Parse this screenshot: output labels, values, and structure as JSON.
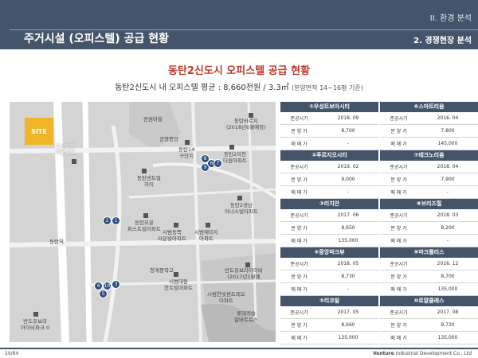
{
  "header": {
    "section": "II. 환경 분석",
    "title": "주거시설 (오피스텔) 공급 현황",
    "subsection": "2. 경쟁현장 분석"
  },
  "main_title": "동탄2신도시 오피스텔 공급 현황",
  "sub_title": "동탄2신도시 내 오피스텔 평균 : 8,660천원 / 3.3㎡",
  "sub_note": "(분양면적 14~16평 기준)",
  "map": {
    "site_label": "SITE",
    "labels": {
      "jeonwon": "전원마을",
      "hanshin": "한신더휴\n어반파크",
      "gongyeong": "공영중앙",
      "dongtan14": "동탄14\n구단지",
      "dongtan_sentral": "동탄센트럴\n자이",
      "dongtan_baruji": "동탄바르지\n(2018년6월예정)",
      "dongtan_ichen": "동탄2이천\n더원아파트",
      "dongtan2_neul": "동탄2경남\n아너스빌아파트",
      "dongtan_ogol": "동탄모골\n퍼스트빌아파트",
      "sibeom_buyeong": "시범동쪽\n라온빌아파트",
      "sibeom_eden": "시범예미지\n아파트",
      "dongtan_station": "동탄역",
      "cheonggye": "청계중학교",
      "sibeom_daewoo": "시범대림\n칸트빌아파트",
      "bandoyu": "반도유보라아이비\n(2017년1월예",
      "sibeom_hanbit": "시범한빛센트레오\n아파트",
      "lotte": "롯데캐슬\n알바트로스",
      "bando_ivy": "반도유보라\n아이비파크 0"
    },
    "pins": [
      "1",
      "2",
      "3",
      "4",
      "5",
      "6",
      "7",
      "8",
      "9",
      "10"
    ]
  },
  "table_labels": {
    "date": "준공시기",
    "price": "분 양 가",
    "sale": "매 매 가"
  },
  "properties": [
    {
      "name": "①우성트보아시티",
      "date": "2018. 09",
      "price": "8,700",
      "sale": "-"
    },
    {
      "name": "⑥스마트리움",
      "date": "2016. 04",
      "price": "7,800",
      "sale": "145,000"
    },
    {
      "name": "②푸르지오시티",
      "date": "2019. 02",
      "price": "9,000",
      "sale": "-"
    },
    {
      "name": "⑦테크노리움",
      "date": "2018. 04",
      "price": "7,900",
      "sale": "-"
    },
    {
      "name": "③리치안",
      "date": "2017. 06",
      "price": "8,650",
      "sale": "135,000"
    },
    {
      "name": "⑧브리즈힐",
      "date": "2018. 03",
      "price": "8,200",
      "sale": "-"
    },
    {
      "name": "④중앙파크뷰",
      "date": "2018. 05",
      "price": "8,730",
      "sale": "-"
    },
    {
      "name": "⑨마크폴리스",
      "date": "2016. 12",
      "price": "8,700",
      "sale": "135,000"
    },
    {
      "name": "⑤리코빌",
      "date": "2017. 05",
      "price": "8,660",
      "sale": "135,000"
    },
    {
      "name": "⑩로얄클래스",
      "date": "2017. 08",
      "price": "8,720",
      "sale": "135,000"
    }
  ],
  "footer": {
    "page": "29/84",
    "company_bold": "Venture",
    "company_rest": " Industrial Development Co., Ltd"
  }
}
